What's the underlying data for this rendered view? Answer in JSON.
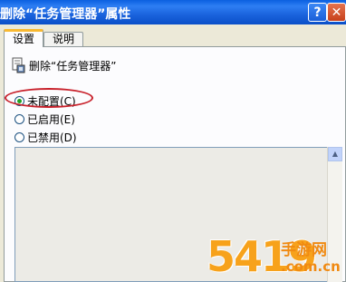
{
  "window": {
    "title": "删除“任务管理器”属性",
    "help_glyph": "?",
    "close_glyph": "✕"
  },
  "tabs": [
    {
      "label": "设置",
      "active": true
    },
    {
      "label": "说明",
      "active": false
    }
  ],
  "policy": {
    "name": "删除“任务管理器”"
  },
  "options": [
    {
      "label": "未配置(C)",
      "checked": true
    },
    {
      "label": "已启用(E)",
      "checked": false
    },
    {
      "label": "已禁用(D)",
      "checked": false
    }
  ],
  "watermark": {
    "number": "5419",
    "text": "手游网",
    "domain": ".com.cn"
  },
  "colors": {
    "titlebar": "#0a5fe0",
    "highlight": "#c8202a",
    "watermark": "#f7a21b"
  }
}
